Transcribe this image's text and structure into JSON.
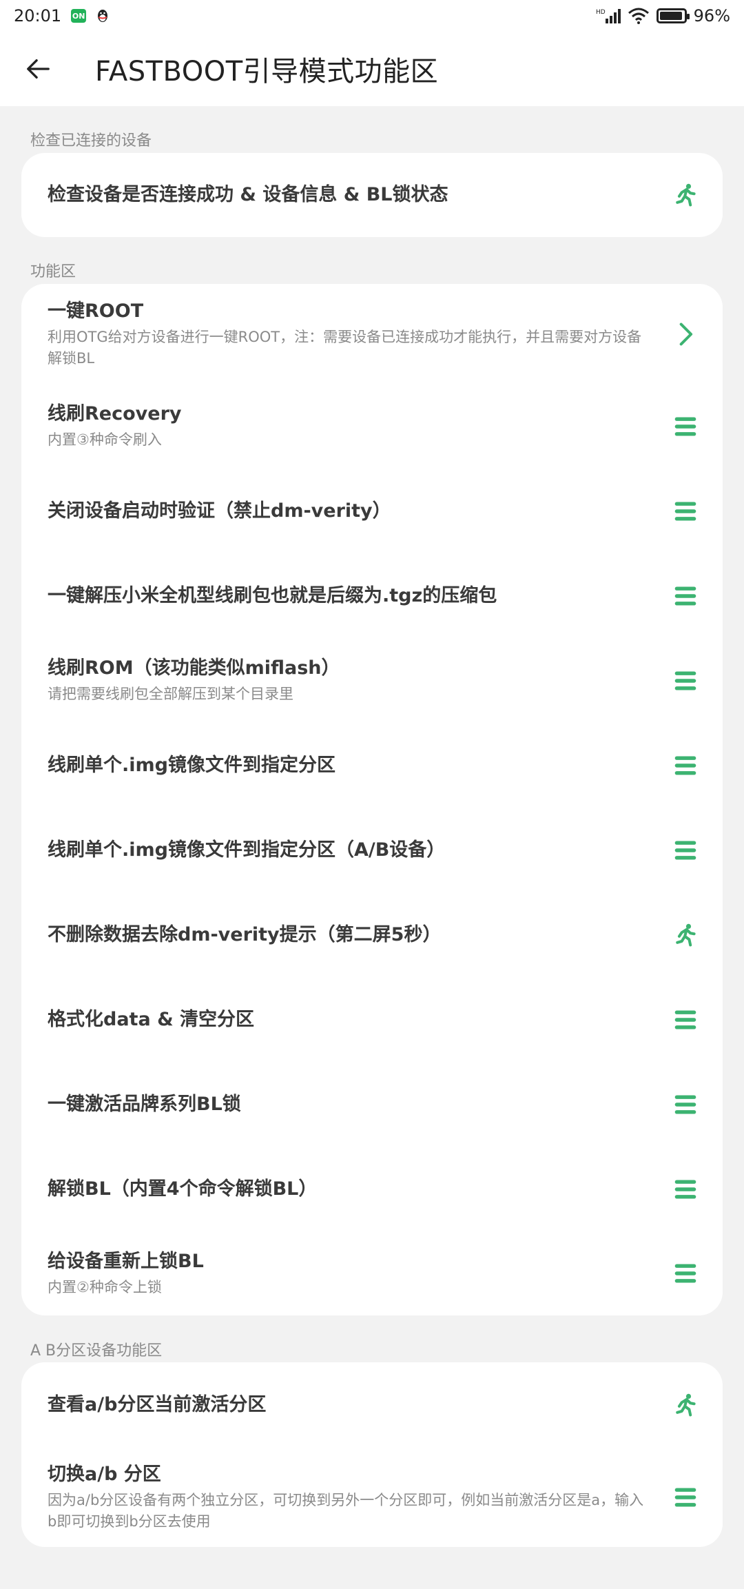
{
  "status_bar": {
    "time": "20:01",
    "battery": "96%",
    "network": "HD"
  },
  "header": {
    "title": "FASTBOOT引导模式功能区"
  },
  "sections": [
    {
      "label": "检查已连接的设备",
      "items": [
        {
          "title": "检查设备是否连接成功 & 设备信息 & BL锁状态",
          "subtitle": "",
          "icon": "run-icon"
        }
      ]
    },
    {
      "label": "功能区",
      "items": [
        {
          "title": "一键ROOT",
          "subtitle": "利用OTG给对方设备进行一键ROOT，注：需要设备已连接成功才能执行，并且需要对方设备解锁BL",
          "icon": "chevron-right-icon"
        },
        {
          "title": "线刷Recovery",
          "subtitle": "内置③种命令刷入",
          "icon": "menu-icon"
        },
        {
          "title": "关闭设备启动时验证（禁止dm-verity）",
          "subtitle": "",
          "icon": "menu-icon"
        },
        {
          "title": "一键解压小米全机型线刷包也就是后缀为.tgz的压缩包",
          "subtitle": "",
          "icon": "menu-icon"
        },
        {
          "title": "线刷ROM（该功能类似miflash）",
          "subtitle": "请把需要线刷包全部解压到某个目录里",
          "icon": "menu-icon"
        },
        {
          "title": "线刷单个.img镜像文件到指定分区",
          "subtitle": "",
          "icon": "menu-icon"
        },
        {
          "title": "线刷单个.img镜像文件到指定分区（A/B设备）",
          "subtitle": "",
          "icon": "menu-icon"
        },
        {
          "title": "不删除数据去除dm-verity提示（第二屏5秒）",
          "subtitle": "",
          "icon": "run-icon"
        },
        {
          "title": "格式化data & 清空分区",
          "subtitle": "",
          "icon": "menu-icon"
        },
        {
          "title": "一键激活品牌系列BL锁",
          "subtitle": "",
          "icon": "menu-icon"
        },
        {
          "title": "解锁BL（内置4个命令解锁BL）",
          "subtitle": "",
          "icon": "menu-icon"
        },
        {
          "title": "给设备重新上锁BL",
          "subtitle": "内置②种命令上锁",
          "icon": "menu-icon"
        }
      ]
    },
    {
      "label": "A B分区设备功能区",
      "items": [
        {
          "title": "查看a/b分区当前激活分区",
          "subtitle": "",
          "icon": "run-icon"
        },
        {
          "title": "切换a/b 分区",
          "subtitle": "因为a/b分区设备有两个独立分区，可切换到另外一个分区即可，例如当前激活分区是a，输入b即可切换到b分区去使用",
          "icon": "menu-icon"
        }
      ]
    }
  ],
  "colors": {
    "accent": "#3cb371",
    "background": "#f2f2f2",
    "card": "#ffffff"
  }
}
